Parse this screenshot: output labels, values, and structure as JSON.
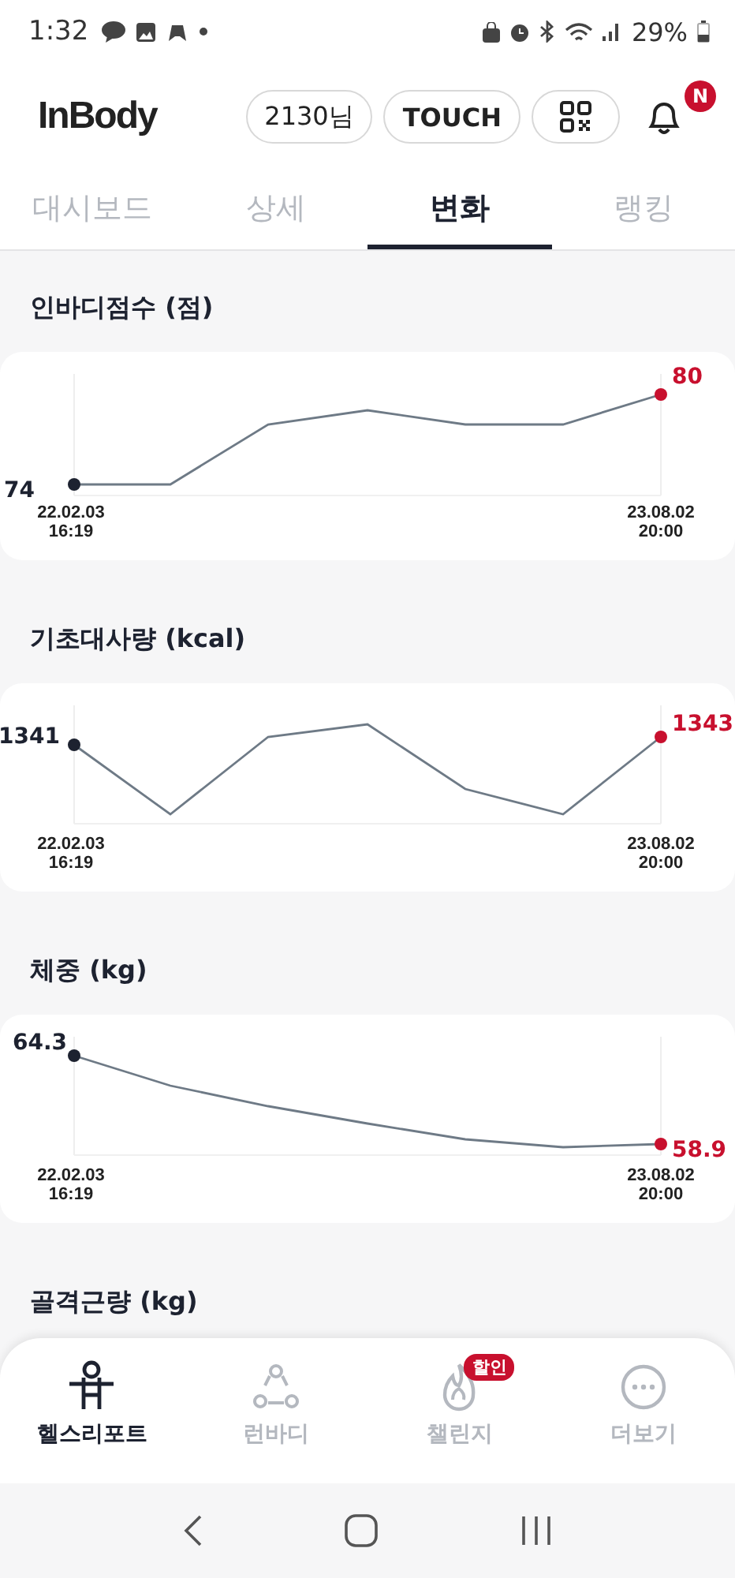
{
  "status_bar": {
    "time": "1:32",
    "battery": "29%"
  },
  "header": {
    "logo": "InBody",
    "user_button": "2130님",
    "touch_button": "TOUCH",
    "notification_badge": "N"
  },
  "tabs": [
    {
      "label": "대시보드",
      "selected": false
    },
    {
      "label": "상세",
      "selected": false
    },
    {
      "label": "변화",
      "selected": true
    },
    {
      "label": "랭킹",
      "selected": false
    }
  ],
  "cards": [
    {
      "title": "인바디점수 (점)",
      "start_value": "74",
      "end_value": "80",
      "start_date": "22.02.03",
      "start_time": "16:19",
      "end_date": "23.08.02",
      "end_time": "20:00"
    },
    {
      "title": "기초대사량 (kcal)",
      "start_value": "1341",
      "end_value": "1343",
      "start_date": "22.02.03",
      "start_time": "16:19",
      "end_date": "23.08.02",
      "end_time": "20:00"
    },
    {
      "title": "체중 (kg)",
      "start_value": "64.3",
      "end_value": "58.9",
      "start_date": "22.02.03",
      "start_time": "16:19",
      "end_date": "23.08.02",
      "end_time": "20:00"
    }
  ],
  "next_section_title": "골격근량 (kg)",
  "bottom_nav": [
    {
      "label": "헬스리포트",
      "selected": true
    },
    {
      "label": "런바디",
      "selected": false
    },
    {
      "label": "챌린지",
      "selected": false,
      "badge": "할인"
    },
    {
      "label": "더보기",
      "selected": false
    }
  ]
}
